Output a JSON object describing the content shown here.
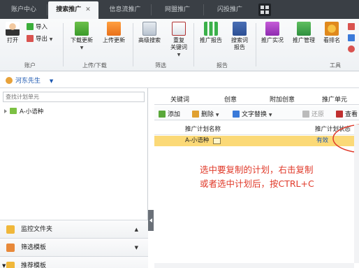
{
  "tabs": [
    {
      "label": "账户中心"
    },
    {
      "label": "搜索推广",
      "close": "✕"
    },
    {
      "label": "信息流推广"
    },
    {
      "label": "网盟推广"
    },
    {
      "label": "闪投推广"
    }
  ],
  "ribbon": {
    "account_group": {
      "open": "打开",
      "import": "导入",
      "export": "导出",
      "label": "账户"
    },
    "updown_group": {
      "download": "下载更新",
      "upload": "上传更新",
      "label": "上传/下载"
    },
    "filter_group": {
      "advanced_search": "高级搜索",
      "dup_kw_1": "重复",
      "dup_kw_2": "关键词",
      "label": "筛选"
    },
    "report_group": {
      "promo_report": "推广报告",
      "search_report_1": "搜索词",
      "search_report_2": "报告",
      "label": "报告"
    },
    "tools_group": {
      "live": "推广实况",
      "manage": "推广管理",
      "rank": "看排名",
      "label": "工具"
    }
  },
  "account": {
    "name": "河东先生"
  },
  "left": {
    "search_placeholder": "查找计划单元",
    "tree_item": "A-小语种",
    "panels": [
      {
        "label": "监控文件夹"
      },
      {
        "label": "筛选模板"
      },
      {
        "label": "推荐模板"
      }
    ]
  },
  "right": {
    "subtabs": [
      "关键词",
      "创意",
      "附加创意",
      "推广单元"
    ],
    "toolbar": {
      "add": "添加",
      "delete": "删除",
      "text_replace": "文字替换",
      "restore": "还原",
      "view": "查看"
    },
    "columns": [
      "推广计划名称",
      "推广计划状态"
    ],
    "row": {
      "name": "A-小语种",
      "status": "有效"
    },
    "annotation_line1": "选中要复制的计划，右击复制",
    "annotation_line2": "或者选中计划后，按CTRL+C"
  },
  "colors": {
    "tabbar": "#3a3f45",
    "highlight": "#fbd977",
    "annotation": "#e03a2a",
    "link": "#1a56b0"
  }
}
